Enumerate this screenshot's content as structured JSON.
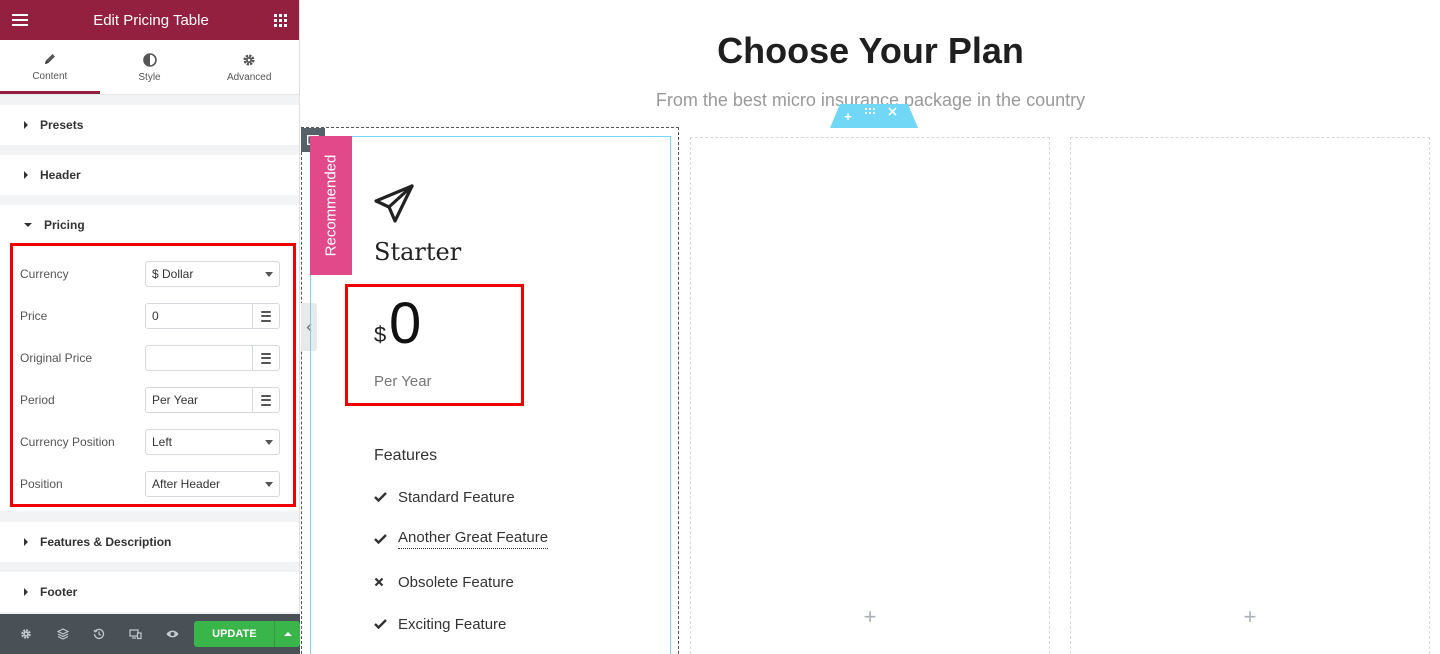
{
  "panel": {
    "title": "Edit Pricing Table",
    "tabs": [
      {
        "label": "Content",
        "icon": "pencil-icon"
      },
      {
        "label": "Style",
        "icon": "half-circle-icon"
      },
      {
        "label": "Advanced",
        "icon": "gear-icon"
      }
    ],
    "sections": {
      "presets": "Presets",
      "header": "Header",
      "pricing": "Pricing",
      "features": "Features & Description",
      "footer": "Footer"
    },
    "pricing_controls": {
      "currency": {
        "label": "Currency",
        "value": "$ Dollar"
      },
      "price": {
        "label": "Price",
        "value": "0"
      },
      "original_price": {
        "label": "Original Price",
        "value": ""
      },
      "period": {
        "label": "Period",
        "value": "Per Year"
      },
      "currency_position": {
        "label": "Currency Position",
        "value": "Left"
      },
      "position": {
        "label": "Position",
        "value": "After Header"
      }
    },
    "update_label": "UPDATE"
  },
  "preview": {
    "title": "Choose Your Plan",
    "subtitle": "From the best micro insurance package in the country",
    "card": {
      "ribbon": "Recommended",
      "plan_name": "Starter",
      "currency": "$",
      "price": "0",
      "period": "Per Year",
      "features_title": "Features",
      "features": [
        {
          "text": "Standard Feature",
          "icon": "check-icon"
        },
        {
          "text": "Another Great Feature",
          "icon": "check-icon"
        },
        {
          "text": "Obsolete Feature",
          "icon": "times-icon"
        },
        {
          "text": "Exciting Feature",
          "icon": "check-icon"
        }
      ]
    },
    "empty_column_symbol": "+"
  },
  "colors": {
    "brand": "#93203e",
    "ribbon": "#e2498a",
    "update": "#39b54a",
    "highlight": "#e00000",
    "section_handle": "#71d7f7"
  }
}
